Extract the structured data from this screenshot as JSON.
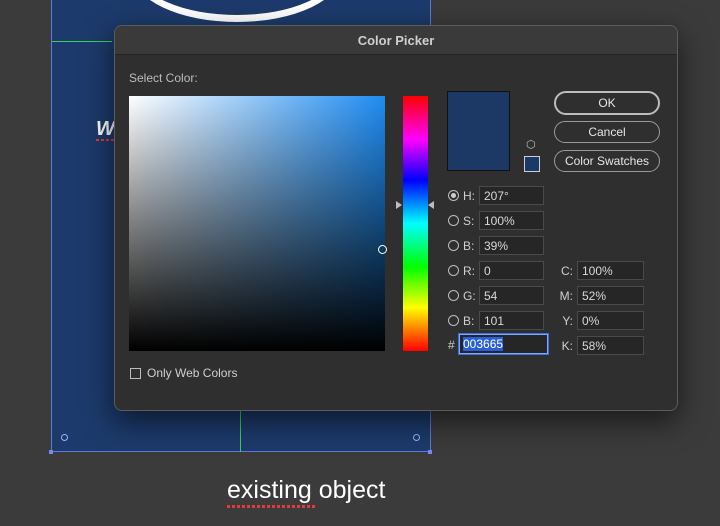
{
  "background": {
    "artboard_text": "W",
    "caption": "existing object"
  },
  "dialog": {
    "title": "Color Picker",
    "select_color_label": "Select Color:",
    "buttons": {
      "ok": "OK",
      "cancel": "Cancel",
      "color_swatches": "Color Swatches"
    },
    "hsb": [
      {
        "label": "H:",
        "value": "207°",
        "selected": true
      },
      {
        "label": "S:",
        "value": "100%",
        "selected": false
      },
      {
        "label": "B:",
        "value": "39%",
        "selected": false
      }
    ],
    "rgb": [
      {
        "label": "R:",
        "value": "0"
      },
      {
        "label": "G:",
        "value": "54"
      },
      {
        "label": "B:",
        "value": "101"
      }
    ],
    "cmyk": [
      {
        "label": "C:",
        "value": "100%"
      },
      {
        "label": "M:",
        "value": "52%"
      },
      {
        "label": "Y:",
        "value": "0%"
      },
      {
        "label": "K:",
        "value": "58%"
      }
    ],
    "hex_prefix": "#",
    "hex_value": "003665",
    "only_web_colors_label": "Only Web Colors",
    "only_web_colors_checked": false,
    "colors": {
      "current": "#003665",
      "artboard": "#1c3a6b"
    },
    "icons": {
      "cube": "cube-icon"
    }
  }
}
